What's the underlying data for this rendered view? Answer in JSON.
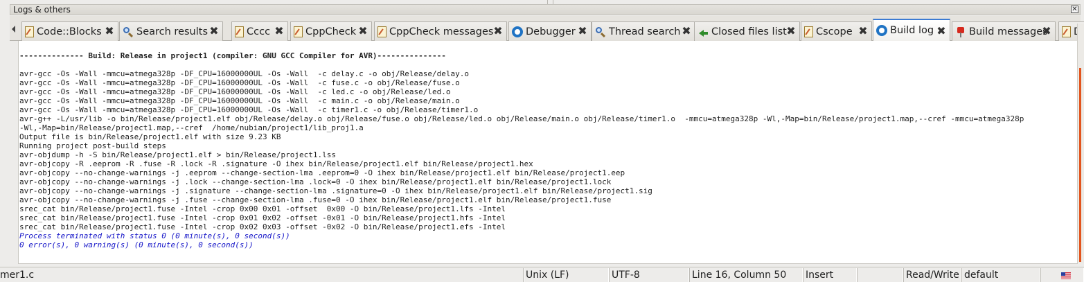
{
  "panel": {
    "title": "Logs & others",
    "close_glyph": "✕"
  },
  "tabs": [
    {
      "label": "Code::Blocks",
      "icon": "document-icon",
      "active": false
    },
    {
      "label": "Search results",
      "icon": "search-icon",
      "active": false
    },
    {
      "label": "Cccc",
      "icon": "document-icon",
      "active": false
    },
    {
      "label": "CppCheck",
      "icon": "document-icon",
      "active": false
    },
    {
      "label": "CppCheck messages",
      "icon": "document-icon",
      "active": false
    },
    {
      "label": "Debugger",
      "icon": "gear-icon",
      "active": false
    },
    {
      "label": "Thread search",
      "icon": "search-icon",
      "active": false
    },
    {
      "label": "Closed files list",
      "icon": "back-arrow-icon",
      "active": false
    },
    {
      "label": "Cscope",
      "icon": "document-icon",
      "active": false
    },
    {
      "label": "Build log",
      "icon": "gear-icon",
      "active": true
    },
    {
      "label": "Build messages",
      "icon": "pin-icon",
      "active": false
    },
    {
      "label": "D",
      "icon": "document-icon",
      "active": false
    }
  ],
  "tab_close_glyph": "✖",
  "log": {
    "lines": [
      {
        "text": "",
        "style": "normal"
      },
      {
        "text": "-------------- Build: Release in project1 (compiler: GNU GCC Compiler for AVR)---------------",
        "style": "bold"
      },
      {
        "text": "",
        "style": "normal"
      },
      {
        "text": "avr-gcc -Os -Wall -mmcu=atmega328p -DF_CPU=16000000UL -Os -Wall  -c delay.c -o obj/Release/delay.o",
        "style": "normal"
      },
      {
        "text": "avr-gcc -Os -Wall -mmcu=atmega328p -DF_CPU=16000000UL -Os -Wall  -c fuse.c -o obj/Release/fuse.o",
        "style": "normal"
      },
      {
        "text": "avr-gcc -Os -Wall -mmcu=atmega328p -DF_CPU=16000000UL -Os -Wall  -c led.c -o obj/Release/led.o",
        "style": "normal"
      },
      {
        "text": "avr-gcc -Os -Wall -mmcu=atmega328p -DF_CPU=16000000UL -Os -Wall  -c main.c -o obj/Release/main.o",
        "style": "normal"
      },
      {
        "text": "avr-gcc -Os -Wall -mmcu=atmega328p -DF_CPU=16000000UL -Os -Wall  -c timer1.c -o obj/Release/timer1.o",
        "style": "normal"
      },
      {
        "text": "avr-g++ -L/usr/lib -o bin/Release/project1.elf obj/Release/delay.o obj/Release/fuse.o obj/Release/led.o obj/Release/main.o obj/Release/timer1.o  -mmcu=atmega328p -Wl,-Map=bin/Release/project1.map,--cref -mmcu=atmega328p",
        "style": "normal"
      },
      {
        "text": "-Wl,-Map=bin/Release/project1.map,--cref  /home/nubian/project1/lib_proj1.a",
        "style": "normal"
      },
      {
        "text": "Output file is bin/Release/project1.elf with size 9.23 KB",
        "style": "normal"
      },
      {
        "text": "Running project post-build steps",
        "style": "normal"
      },
      {
        "text": "avr-objdump -h -S bin/Release/project1.elf > bin/Release/project1.lss",
        "style": "normal"
      },
      {
        "text": "avr-objcopy -R .eeprom -R .fuse -R .lock -R .signature -O ihex bin/Release/project1.elf bin/Release/project1.hex",
        "style": "normal"
      },
      {
        "text": "avr-objcopy --no-change-warnings -j .eeprom --change-section-lma .eeprom=0 -O ihex bin/Release/project1.elf bin/Release/project1.eep",
        "style": "normal"
      },
      {
        "text": "avr-objcopy --no-change-warnings -j .lock --change-section-lma .lock=0 -O ihex bin/Release/project1.elf bin/Release/project1.lock",
        "style": "normal"
      },
      {
        "text": "avr-objcopy --no-change-warnings -j .signature --change-section-lma .signature=0 -O ihex bin/Release/project1.elf bin/Release/project1.sig",
        "style": "normal"
      },
      {
        "text": "avr-objcopy --no-change-warnings -j .fuse --change-section-lma .fuse=0 -O ihex bin/Release/project1.elf bin/Release/project1.fuse",
        "style": "normal"
      },
      {
        "text": "srec_cat bin/Release/project1.fuse -Intel -crop 0x00 0x01 -offset  0x00 -O bin/Release/project1.lfs -Intel",
        "style": "normal"
      },
      {
        "text": "srec_cat bin/Release/project1.fuse -Intel -crop 0x01 0x02 -offset -0x01 -O bin/Release/project1.hfs -Intel",
        "style": "normal"
      },
      {
        "text": "srec_cat bin/Release/project1.fuse -Intel -crop 0x02 0x03 -offset -0x02 -O bin/Release/project1.efs -Intel",
        "style": "normal"
      },
      {
        "text": "Process terminated with status 0 (0 minute(s), 0 second(s))",
        "style": "italic"
      },
      {
        "text": "0 error(s), 0 warning(s) (0 minute(s), 0 second(s))",
        "style": "italic"
      }
    ]
  },
  "statusbar": {
    "file": "mer1.c",
    "eol": "Unix (LF)",
    "encoding": "UTF-8",
    "position": "Line 16, Column 50",
    "mode": "Insert",
    "access": "Read/Write",
    "profile": "default"
  }
}
